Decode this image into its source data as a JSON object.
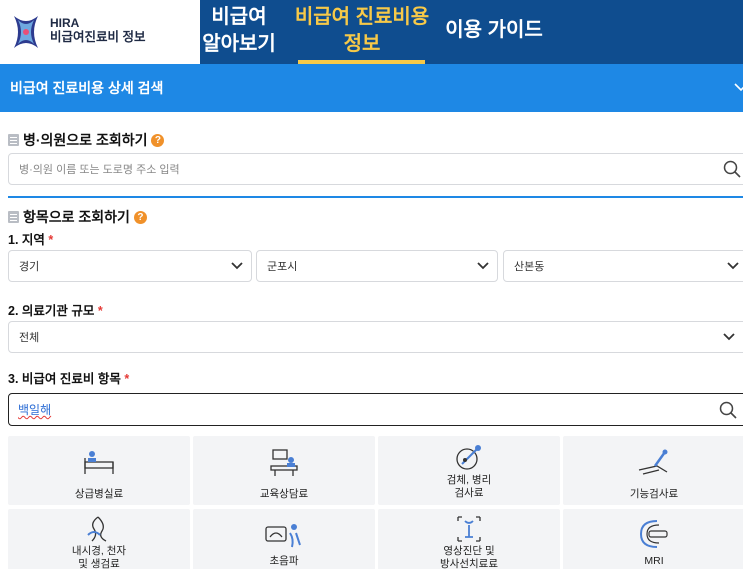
{
  "header": {
    "logo_title": "HIRA",
    "logo_sub": "비급여진료비 정보",
    "nav": [
      {
        "line1": "비급여",
        "line2": "알아보기"
      },
      {
        "line1": "비급여 진료비용",
        "line2": "정보"
      },
      {
        "line1": "이용 가이드",
        "line2": ""
      }
    ],
    "active_color": "#f7c948",
    "bg_color": "#0f4d8f"
  },
  "accordion": {
    "label": "비급여 진료비용 상세 검색",
    "icon": "chevron-down-icon",
    "color": "#1e88e5"
  },
  "hospital_search": {
    "title": "병·의원으로 조회하기",
    "placeholder": "병·의원 이름 또는 도로명 주소 입력",
    "help": "?"
  },
  "item_search": {
    "title": "항목으로 조회하기",
    "help": "?",
    "region_label": "1. 지역",
    "region": {
      "province": "경기",
      "city": "군포시",
      "dong": "산본동"
    },
    "scale_label": "2. 의료기관 규모",
    "scale": "전체",
    "item_label": "3. 비급여 진료비 항목",
    "item_value": "백일해",
    "required_mark": "*"
  },
  "categories": [
    {
      "label": "상급병실료",
      "icon": "hospital-bed-icon"
    },
    {
      "label": "교육상담료",
      "icon": "consultation-icon"
    },
    {
      "label_line1": "검체, 병리",
      "label_line2": "검사료",
      "icon": "microscope-icon"
    },
    {
      "label": "기능검사료",
      "icon": "function-test-icon"
    },
    {
      "label_line1": "내시경, 천자",
      "label_line2": "및 생검료",
      "icon": "endoscope-icon"
    },
    {
      "label": "초음파",
      "icon": "ultrasound-icon"
    },
    {
      "label_line1": "영상진단 및",
      "label_line2": "방사선치료료",
      "icon": "xray-icon"
    },
    {
      "label": "MRI",
      "icon": "mri-icon"
    }
  ]
}
